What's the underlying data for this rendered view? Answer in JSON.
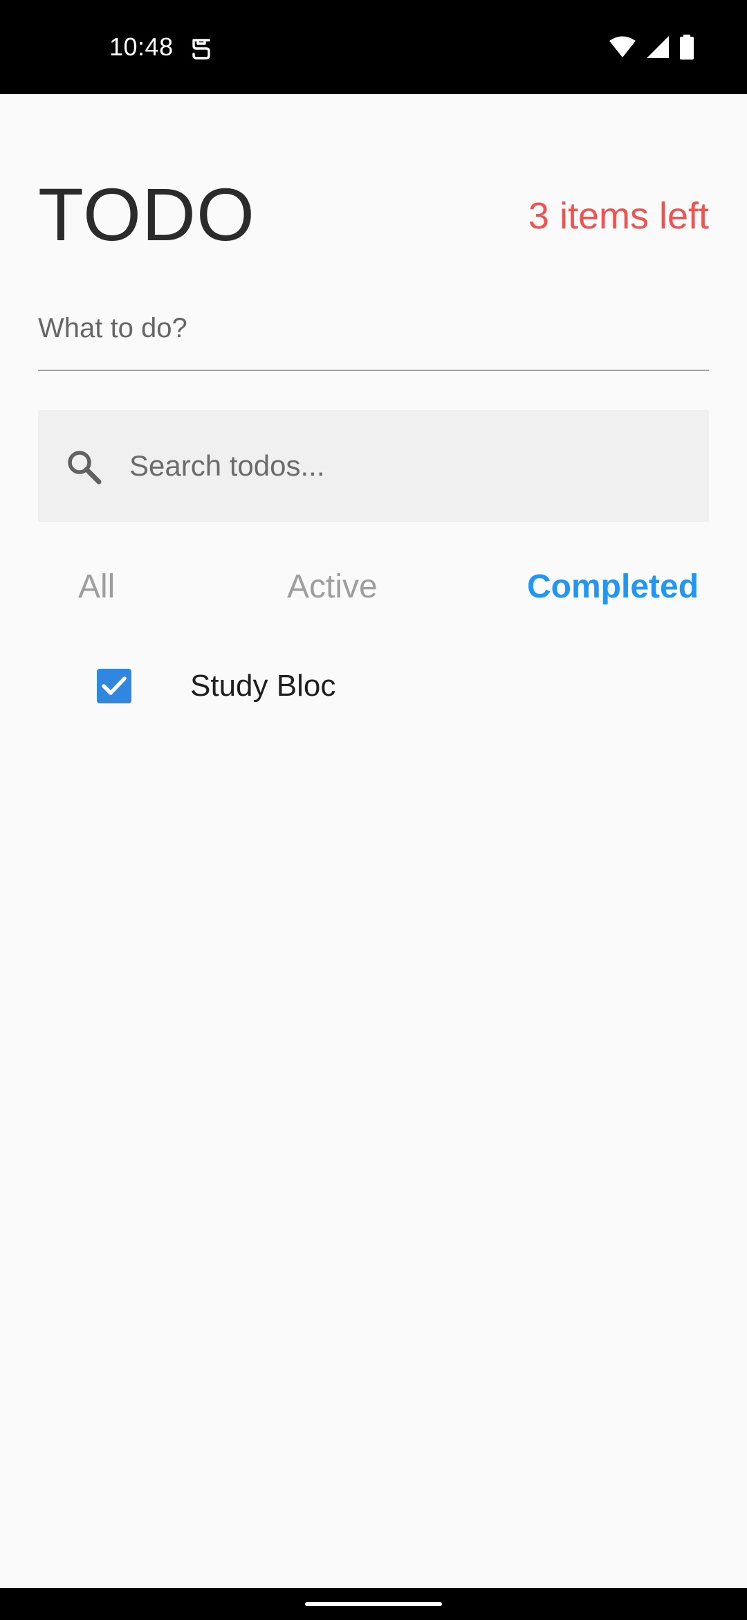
{
  "status_bar": {
    "time": "10:48",
    "app_icon": "notification-icon",
    "wifi_icon": "wifi-icon",
    "signal_icon": "signal-icon",
    "battery_icon": "battery-icon"
  },
  "header": {
    "title": "TODO",
    "items_left": "3 items left"
  },
  "new_todo": {
    "placeholder": "What to do?",
    "value": ""
  },
  "search": {
    "icon": "search-icon",
    "placeholder": "Search todos...",
    "value": ""
  },
  "filters": {
    "all": "All",
    "active": "Active",
    "completed": "Completed",
    "selected": "completed"
  },
  "todos": [
    {
      "text": "Study Bloc",
      "completed": true
    }
  ],
  "colors": {
    "accent": "#2196f3",
    "items_left": "#ef5350",
    "checkbox": "#2f87e2",
    "background": "#fafafa"
  }
}
